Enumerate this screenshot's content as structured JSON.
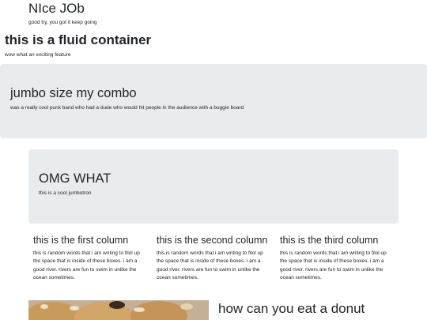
{
  "header": {
    "title": "NIce JOb",
    "subtitle": "good try, you got it keep going"
  },
  "fluid": {
    "title": "this is a fluid container",
    "subtitle": "wow what an exciting feature"
  },
  "jumbotron_full": {
    "title": "jumbo size my combo",
    "text": "was a really cool punk band who had a dude who would hit people in the audience with a buggie board"
  },
  "jumbotron_box": {
    "title": "OMG WHAT",
    "text": "this is a cool jumbotron"
  },
  "columns": [
    {
      "title": "this is the first column",
      "text": "this is random words that i am writing to filol up the space that is inside of these boxes. i am a good river. rivers are fun to swim in unlike the ocean sometimes."
    },
    {
      "title": "this is the second column",
      "text": "this is random words that i am writing to filol up the space that is inside of these boxes. i am a good river. rivers are fun to swim in unlike the ocean sometimes."
    },
    {
      "title": "this is the third column",
      "text": "this is random words that i am writing to filol up the space that is inside of these boxes. i am a good river. rivers are fun to swim in unlike the ocean sometimes."
    }
  ],
  "feature": {
    "image_icon": "donut-photo-icon",
    "title": "how can you eat a donut"
  },
  "colors": {
    "jumbotron_bg": "#e9ecef",
    "text": "#212529",
    "background": "#ffffff"
  }
}
